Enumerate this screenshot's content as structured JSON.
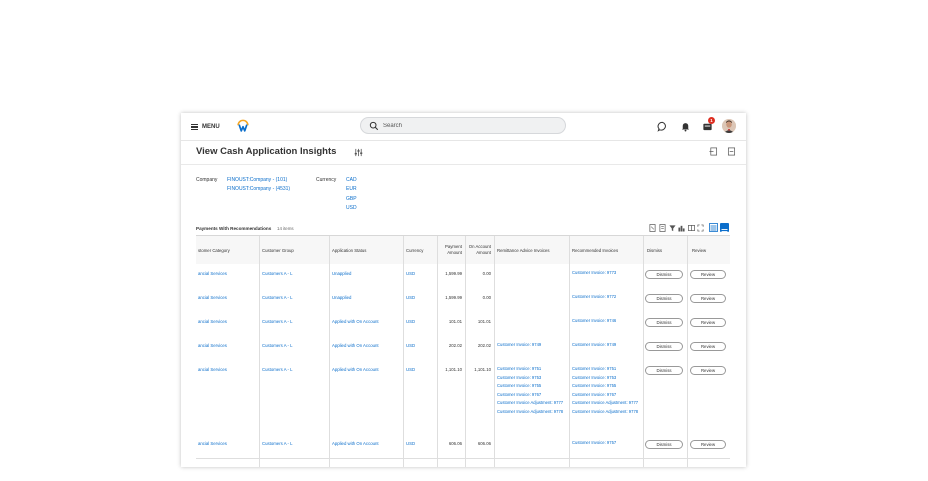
{
  "topbar": {
    "menu_label": "MENU",
    "search_placeholder": "Search",
    "inbox_badge": "1"
  },
  "page": {
    "title": "View Cash Application Insights"
  },
  "filters": {
    "company_label": "Company",
    "companies": [
      "FINOUST:Company - (101)",
      "FINOUST:Company - (4531)"
    ],
    "currency_label": "Currency",
    "currencies": [
      "CAD",
      "EUR",
      "GBP",
      "USD"
    ]
  },
  "grid": {
    "title": "Payments With Recommendations",
    "count": "14 items",
    "headers": {
      "category": "stomer Category",
      "group": "Customer Group",
      "status": "Application Status",
      "currency": "Currency",
      "payment_amount": "Payment Amount",
      "on_account": "On Account Amount",
      "remittance": "Remittance Advice Invoices",
      "recommended": "Recommended Invoices",
      "dismiss": "Dismiss",
      "review": "Review"
    },
    "rows": [
      {
        "category": "ancial Services",
        "group": "Customers A - L",
        "status": "Unapplied",
        "currency": "USD",
        "payment": "1,599.99",
        "on_account": "0.00",
        "remittance": [],
        "recommended": [
          "Customer Invoice: 9773"
        ],
        "dismiss": "Dismiss",
        "review": "Review"
      },
      {
        "category": "ancial Services",
        "group": "Customers A - L",
        "status": "Unapplied",
        "currency": "USD",
        "payment": "1,599.99",
        "on_account": "0.00",
        "remittance": [],
        "recommended": [
          "Customer Invoice: 9772"
        ],
        "dismiss": "Dismiss",
        "review": "Review"
      },
      {
        "category": "ancial Services",
        "group": "Customers A - L",
        "status": "Applied with On Account",
        "currency": "USD",
        "payment": "101.01",
        "on_account": "101.01",
        "remittance": [],
        "recommended": [
          "Customer Invoice: 9746"
        ],
        "dismiss": "Dismiss",
        "review": "Review"
      },
      {
        "category": "ancial Services",
        "group": "Customers A - L",
        "status": "Applied with On Account",
        "currency": "USD",
        "payment": "202.02",
        "on_account": "202.02",
        "remittance": [
          "Customer Invoice: 9749"
        ],
        "recommended": [
          "Customer Invoice: 9749"
        ],
        "dismiss": "Dismiss",
        "review": "Review"
      },
      {
        "category": "ancial Services",
        "group": "Customers A - L",
        "status": "Applied with On Account",
        "currency": "USD",
        "payment": "1,101.10",
        "on_account": "1,101.10",
        "remittance": [
          "Customer Invoice: 9751",
          "Customer Invoice: 9753",
          "Customer Invoice: 9755",
          "Customer Invoice: 9767",
          "Customer Invoice Adjustment: 9777",
          "Customer Invoice Adjustment: 9778"
        ],
        "recommended": [
          "Customer Invoice: 9751",
          "Customer Invoice: 9753",
          "Customer Invoice: 9755",
          "Customer Invoice: 9767",
          "Customer Invoice Adjustment: 9777",
          "Customer Invoice Adjustment: 9778"
        ],
        "dismiss": "Dismiss",
        "review": "Review"
      },
      {
        "category": "ancial Services",
        "group": "Customers A - L",
        "status": "Applied with On Account",
        "currency": "USD",
        "payment": "606.06",
        "on_account": "606.06",
        "remittance": [],
        "recommended": [
          "Customer Invoice: 9757"
        ],
        "dismiss": "Dismiss",
        "review": "Review"
      }
    ]
  }
}
